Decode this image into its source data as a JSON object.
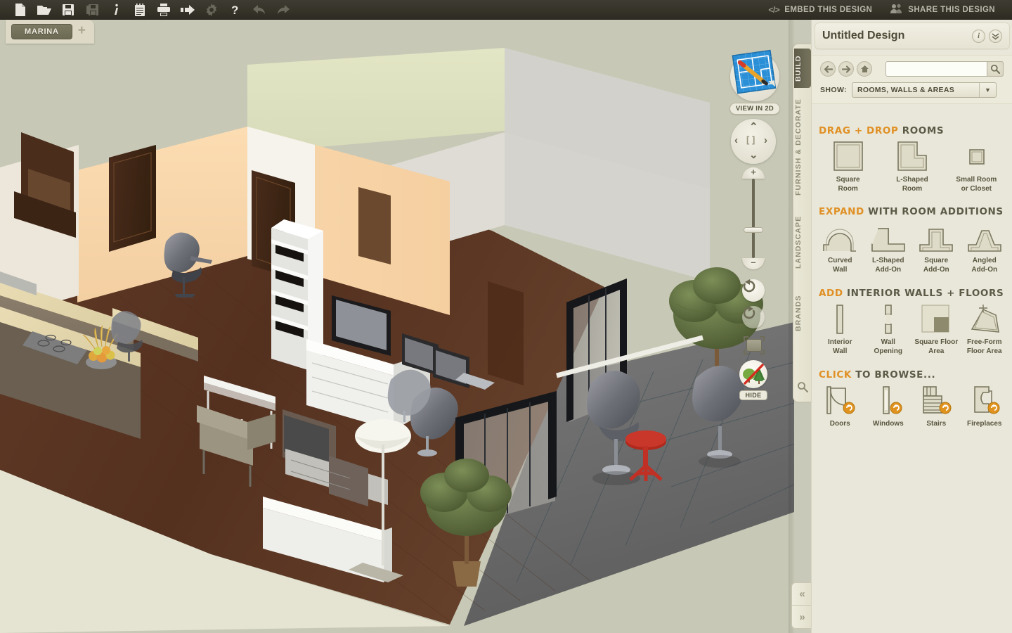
{
  "toolbar": {
    "icons": [
      {
        "name": "new-document-icon",
        "label": "New",
        "dim": false
      },
      {
        "name": "open-folder-icon",
        "label": "Open",
        "dim": false
      },
      {
        "name": "save-icon",
        "label": "Save",
        "dim": false
      },
      {
        "name": "save-as-icon",
        "label": "Save As",
        "dim": true
      },
      {
        "name": "info-icon",
        "label": "Info",
        "dim": false
      },
      {
        "name": "notes-icon",
        "label": "Notes",
        "dim": false
      },
      {
        "name": "print-icon",
        "label": "Print",
        "dim": false
      },
      {
        "name": "export-icon",
        "label": "Export",
        "dim": false
      },
      {
        "name": "settings-gear-icon",
        "label": "Settings",
        "dim": true
      },
      {
        "name": "help-icon",
        "label": "Help",
        "dim": false
      },
      {
        "name": "undo-icon",
        "label": "Undo",
        "dim": true
      },
      {
        "name": "redo-icon",
        "label": "Redo",
        "dim": true
      }
    ],
    "embed_label": "EMBED THIS DESIGN",
    "embed_glyph": "</>",
    "share_label": "SHARE THIS DESIGN"
  },
  "tabs": {
    "documents": [
      "MARINA"
    ],
    "add_label": "+"
  },
  "viewport": {
    "view_in_2d_label": "VIEW IN 2D",
    "hide_label": "HIDE",
    "pan": {
      "up": "⌃",
      "down": "⌄",
      "left": "‹",
      "right": "›",
      "center": "[ ]"
    },
    "zoom": {
      "plus": "+",
      "minus": "–"
    },
    "rotate_left_name": "rotate-left-icon",
    "rotate_right_name": "rotate-right-icon"
  },
  "rail": {
    "tabs": [
      {
        "id": "build",
        "label": "BUILD",
        "active": true
      },
      {
        "id": "furnish",
        "label": "FURNISH & DECORATE",
        "active": false
      },
      {
        "id": "landscape",
        "label": "LANDSCAPE",
        "active": false
      },
      {
        "id": "brands",
        "label": "BRANDS",
        "active": false
      }
    ]
  },
  "panel": {
    "title": "Untitled Design",
    "title_buttons": [
      {
        "name": "info-button",
        "glyph": "i"
      },
      {
        "name": "collapse-panel-button",
        "glyph": "»"
      }
    ],
    "nav": [
      {
        "name": "back-button",
        "glyph": "←"
      },
      {
        "name": "forward-button",
        "glyph": "→"
      },
      {
        "name": "home-button",
        "glyph": "⌂"
      }
    ],
    "search": {
      "value": "",
      "placeholder": ""
    },
    "show_label": "SHOW:",
    "show_value": "ROOMS, WALLS & AREAS",
    "show_options": [
      "ROOMS, WALLS & AREAS"
    ],
    "sections": [
      {
        "id": "drag-drop-rooms",
        "head_accent": "DRAG + DROP",
        "head_rest": " ROOMS",
        "items": [
          {
            "id": "square-room",
            "caption": "Square\nRoom",
            "icon": "square-room-icon"
          },
          {
            "id": "l-shaped-room",
            "caption": "L-Shaped\nRoom",
            "icon": "l-shaped-room-icon"
          },
          {
            "id": "small-room-closet",
            "caption": "Small Room\nor Closet",
            "icon": "small-room-icon"
          }
        ]
      },
      {
        "id": "room-additions",
        "head_accent": "EXPAND",
        "head_rest": " WITH ROOM ADDITIONS",
        "items": [
          {
            "id": "curved-wall",
            "caption": "Curved\nWall",
            "icon": "curved-wall-icon"
          },
          {
            "id": "l-shaped-add-on",
            "caption": "L-Shaped\nAdd-On",
            "icon": "l-shaped-addon-icon"
          },
          {
            "id": "square-add-on",
            "caption": "Square\nAdd-On",
            "icon": "square-addon-icon"
          },
          {
            "id": "angled-add-on",
            "caption": "Angled\nAdd-On",
            "icon": "angled-addon-icon"
          }
        ]
      },
      {
        "id": "interior-walls-floors",
        "head_accent": "ADD",
        "head_rest": " INTERIOR WALLS + FLOORS",
        "items": [
          {
            "id": "interior-wall",
            "caption": "Interior\nWall",
            "icon": "interior-wall-icon"
          },
          {
            "id": "wall-opening",
            "caption": "Wall\nOpening",
            "icon": "wall-opening-icon"
          },
          {
            "id": "square-floor-area",
            "caption": "Square Floor\nArea",
            "icon": "square-floor-icon"
          },
          {
            "id": "free-form-floor-area",
            "caption": "Free-Form\nFloor Area",
            "icon": "free-form-floor-icon"
          }
        ]
      },
      {
        "id": "click-to-browse",
        "head_accent": "CLICK",
        "head_rest": " TO BROWSE...",
        "items": [
          {
            "id": "doors",
            "caption": "Doors",
            "icon": "door-icon",
            "badge": true
          },
          {
            "id": "windows",
            "caption": "Windows",
            "icon": "window-icon",
            "badge": true
          },
          {
            "id": "stairs",
            "caption": "Stairs",
            "icon": "stairs-icon",
            "badge": true
          },
          {
            "id": "fireplaces",
            "caption": "Fireplaces",
            "icon": "fireplace-icon",
            "badge": true
          }
        ]
      }
    ]
  },
  "collapse": {
    "prev": "«",
    "next": "»"
  },
  "colors": {
    "accent_orange": "#e09024",
    "toolbar_dark": "#36332a",
    "panel_bg": "#e9e7d9",
    "canvas_bg": "#c8c8b6",
    "tab_active": "#6d6a54",
    "floor_wood": "#5a3423",
    "wall_peach": "#f7d5a8",
    "wall_green": "#dfe2c4",
    "wall_white": "#f2efe8",
    "terrace_gray": "#6e6e6e"
  }
}
